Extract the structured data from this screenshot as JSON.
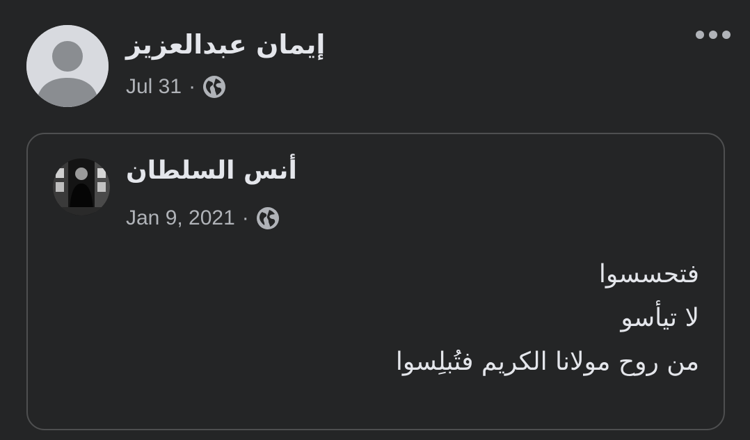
{
  "post": {
    "author": "إيمان عبدالعزيز",
    "date": "Jul 31",
    "separator": "·",
    "privacy_icon": "globe-icon",
    "more_icon": "more-options-icon"
  },
  "shared_post": {
    "author": "أنس السلطان",
    "date": "Jan 9, 2021",
    "separator": "·",
    "privacy_icon": "globe-icon",
    "lines": [
      "فتحسسوا",
      "لا تيأسو",
      "من روح مولانا الكريم فتُبلِسوا"
    ]
  },
  "colors": {
    "background": "#242526",
    "primary_text": "#e4e6eb",
    "secondary_text": "#b0b3b8",
    "border": "#4e4f50"
  }
}
